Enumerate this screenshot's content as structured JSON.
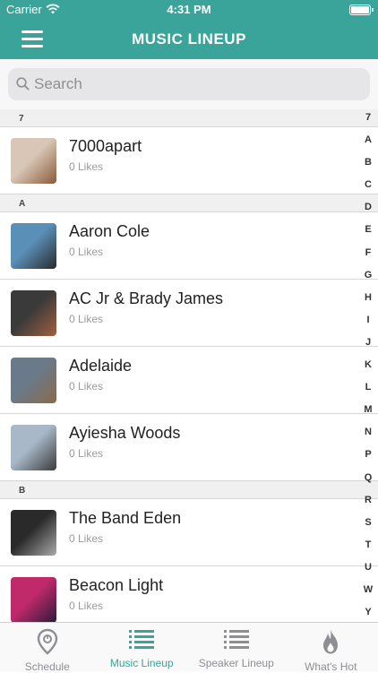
{
  "status": {
    "carrier": "Carrier",
    "time": "4:31 PM"
  },
  "nav": {
    "title": "MUSIC LINEUP"
  },
  "search": {
    "placeholder": "Search",
    "value": ""
  },
  "sections": [
    {
      "letter": "7",
      "items": [
        {
          "name": "7000apart",
          "likes": "0 Likes",
          "colors": [
            "#d8c7b7",
            "#8a5a3a"
          ]
        }
      ]
    },
    {
      "letter": "A",
      "items": [
        {
          "name": "Aaron Cole",
          "likes": "0 Likes",
          "colors": [
            "#5a8fb8",
            "#2a2a2a"
          ]
        },
        {
          "name": "AC Jr & Brady James",
          "likes": "0 Likes",
          "colors": [
            "#3a3a3a",
            "#a06040"
          ]
        },
        {
          "name": "Adelaide",
          "likes": "0 Likes",
          "colors": [
            "#6a7a8a",
            "#8a6a4a"
          ]
        },
        {
          "name": "Ayiesha Woods",
          "likes": "0 Likes",
          "colors": [
            "#a8b8c8",
            "#3a3a3a"
          ]
        }
      ]
    },
    {
      "letter": "B",
      "items": [
        {
          "name": "The Band Eden",
          "likes": "0 Likes",
          "colors": [
            "#2a2a2a",
            "#aaaaaa"
          ]
        },
        {
          "name": "Beacon Light",
          "likes": "0 Likes",
          "colors": [
            "#c02a6a",
            "#2a1a3a"
          ]
        }
      ]
    }
  ],
  "index_letters": [
    "7",
    "A",
    "B",
    "C",
    "D",
    "E",
    "F",
    "G",
    "H",
    "I",
    "J",
    "K",
    "L",
    "M",
    "N",
    "P",
    "Q",
    "R",
    "S",
    "T",
    "U",
    "W",
    "Y"
  ],
  "tabs": [
    {
      "label": "Schedule",
      "icon": "map-pin-icon",
      "active": false
    },
    {
      "label": "Music Lineup",
      "icon": "list-icon",
      "active": true
    },
    {
      "label": "Speaker Lineup",
      "icon": "list-icon",
      "active": false
    },
    {
      "label": "What's Hot",
      "icon": "flame-icon",
      "active": false
    }
  ],
  "colors": {
    "accent": "#3aa39a",
    "tab_inactive": "#8e8e93"
  }
}
